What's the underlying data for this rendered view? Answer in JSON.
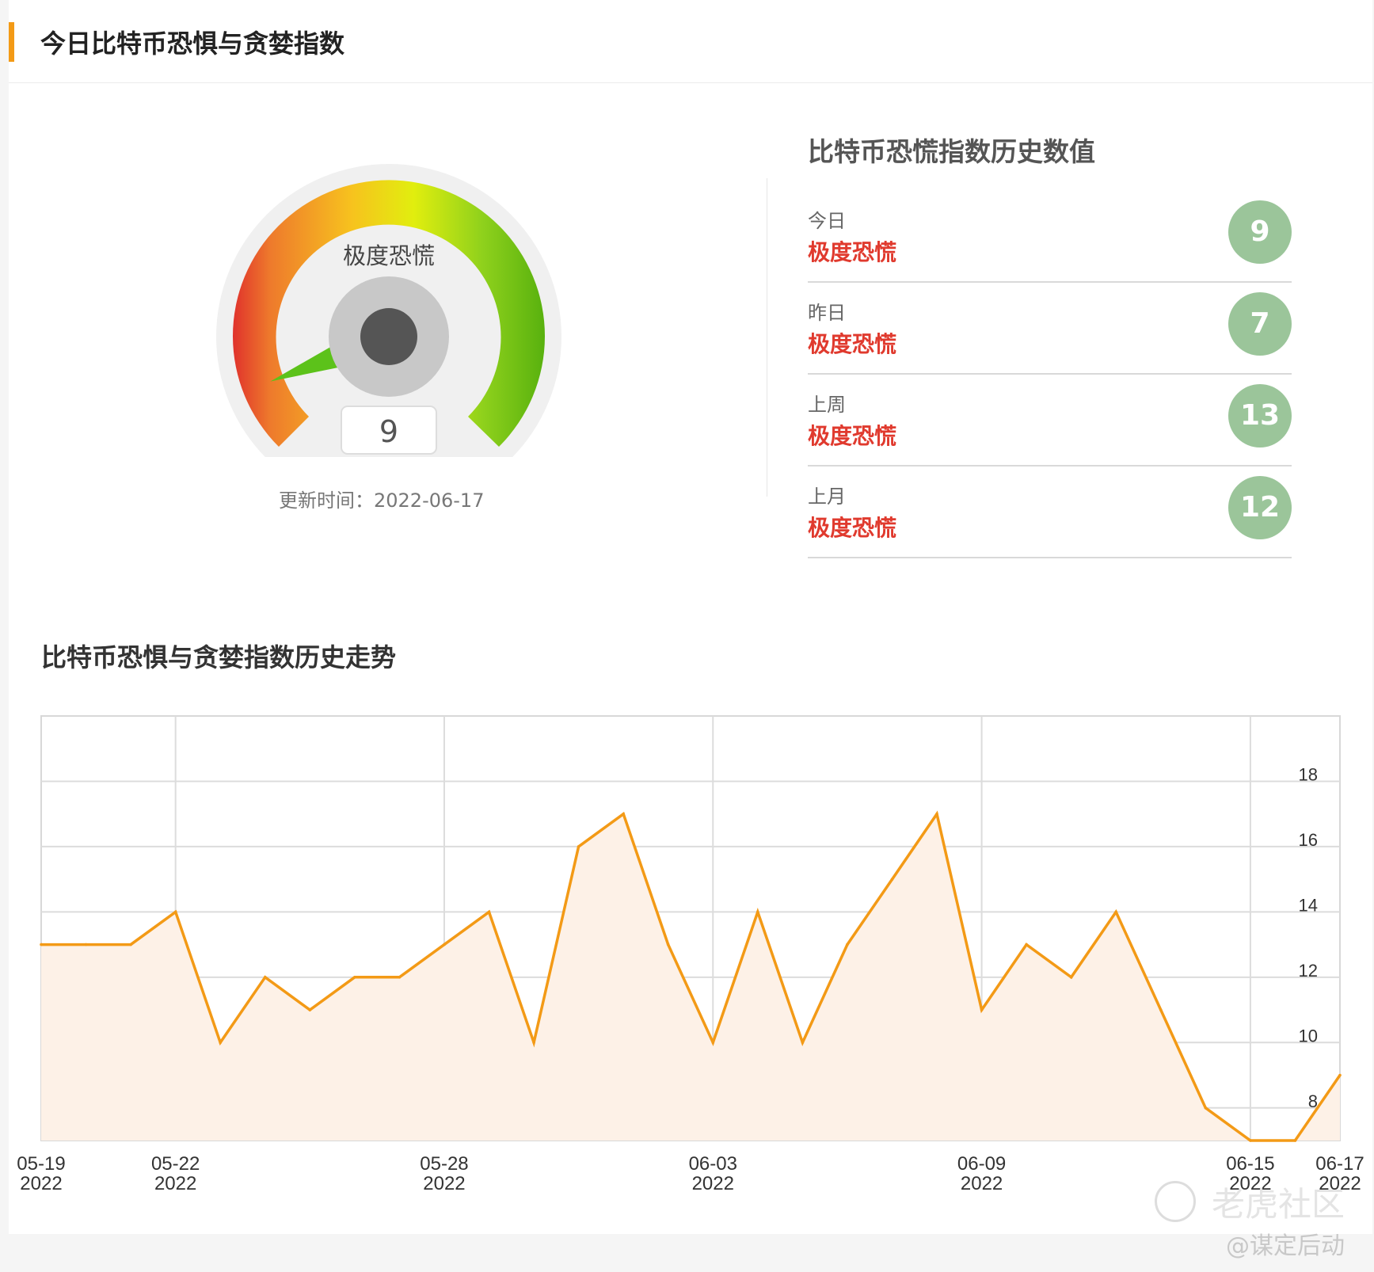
{
  "header": {
    "title": "今日比特币恐惧与贪婪指数",
    "accent": "#f39a16"
  },
  "gauge": {
    "value": 9,
    "value_text": "9",
    "status": "极度恐慌",
    "update_text": "更新时间：2022-06-17",
    "needle_color": "#5cc21a"
  },
  "history": {
    "title": "比特币恐慌指数历史数值",
    "rows": [
      {
        "label": "今日",
        "status": "极度恐慌",
        "value": "9"
      },
      {
        "label": "昨日",
        "status": "极度恐慌",
        "value": "7"
      },
      {
        "label": "上周",
        "status": "极度恐慌",
        "value": "13"
      },
      {
        "label": "上月",
        "status": "极度恐慌",
        "value": "12"
      }
    ],
    "status_color": "#e03a2e",
    "circle_color": "#9bc59a"
  },
  "trend": {
    "title": "比特币恐惧与贪婪指数历史走势"
  },
  "chart_data": {
    "type": "area",
    "x": [
      "05-19",
      "05-20",
      "05-21",
      "05-22",
      "05-23",
      "05-24",
      "05-25",
      "05-26",
      "05-27",
      "05-28",
      "05-29",
      "05-30",
      "05-31",
      "06-01",
      "06-02",
      "06-03",
      "06-04",
      "06-05",
      "06-06",
      "06-07",
      "06-08",
      "06-09",
      "06-10",
      "06-11",
      "06-12",
      "06-13",
      "06-14",
      "06-15",
      "06-16",
      "06-17"
    ],
    "series": [
      {
        "values": [
          13,
          13,
          13,
          14,
          10,
          12,
          11,
          12,
          12,
          13,
          14,
          10,
          16,
          17,
          13,
          10,
          14,
          10,
          13,
          15,
          17,
          11,
          13,
          12,
          14,
          11,
          8,
          7,
          7,
          9
        ]
      }
    ],
    "xticks": [
      {
        "date": "05-19",
        "year": "2022"
      },
      {
        "date": "05-22",
        "year": "2022"
      },
      {
        "date": "05-28",
        "year": "2022"
      },
      {
        "date": "06-03",
        "year": "2022"
      },
      {
        "date": "06-09",
        "year": "2022"
      },
      {
        "date": "06-15",
        "year": "2022"
      },
      {
        "date": "06-17",
        "year": "2022"
      }
    ],
    "yticks": [
      8,
      10,
      12,
      14,
      16,
      18
    ],
    "ylim": [
      7,
      20
    ],
    "grid": true,
    "line_color": "#f39a16",
    "fill_color": "#fdf1e7"
  },
  "watermark": {
    "brand": "老虎社区",
    "author": "@谋定后动"
  }
}
